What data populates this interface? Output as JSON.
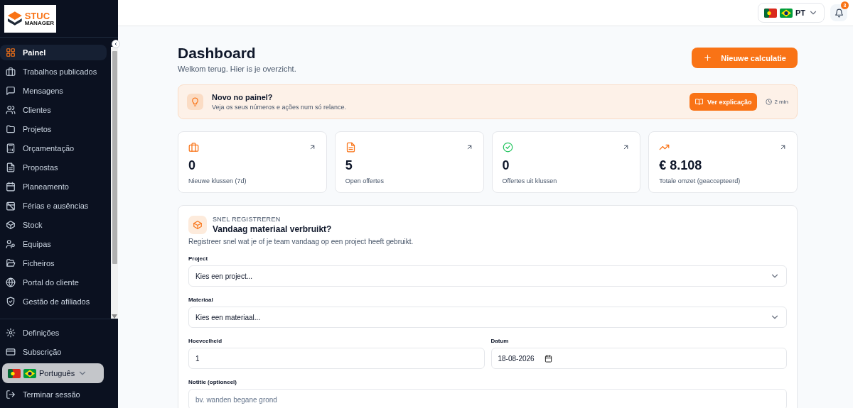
{
  "sidebar": {
    "logo": {
      "word": "STUC",
      "subword": "MANAGER"
    },
    "items": [
      {
        "label": "Painel",
        "selected": true
      },
      {
        "label": "Trabalhos publicados",
        "selected": false
      },
      {
        "label": "Mensagens",
        "selected": false
      },
      {
        "label": "Clientes",
        "selected": false
      },
      {
        "label": "Projetos",
        "selected": false
      },
      {
        "label": "Orçamentação",
        "selected": false
      },
      {
        "label": "Propostas",
        "selected": false
      },
      {
        "label": "Planeamento",
        "selected": false
      },
      {
        "label": "Férias e ausências",
        "selected": false
      },
      {
        "label": "Stock",
        "selected": false
      },
      {
        "label": "Equipas",
        "selected": false
      },
      {
        "label": "Ficheiros",
        "selected": false
      },
      {
        "label": "Portal do cliente",
        "selected": false
      },
      {
        "label": "Gestão de afiliados",
        "selected": false
      }
    ],
    "footer_items": [
      {
        "label": "Definições"
      },
      {
        "label": "Subscrição"
      }
    ],
    "language": "Português",
    "logout": "Terminar sessão"
  },
  "topbar": {
    "language": "PT",
    "notifications": "3"
  },
  "header": {
    "title": "Dashboard",
    "subtitle": "Welkom terug. Hier is je overzicht.",
    "action": "Nieuwe calculatie"
  },
  "banner": {
    "title": "Novo no painel?",
    "text": "Veja os seus números e ações num só relance.",
    "button": "Ver explicação",
    "duration": "2 min"
  },
  "stats": [
    {
      "value": "0",
      "label": "Nieuwe klussen (7d)"
    },
    {
      "value": "5",
      "label": "Open offertes"
    },
    {
      "value": "0",
      "label": "Offertes uit klussen"
    },
    {
      "value": "€ 8.108",
      "label": "Totale omzet (geaccepteerd)"
    }
  ],
  "quick": {
    "eyebrow": "SNEL REGISTREREN",
    "title": "Vandaag materiaal verbruikt?",
    "text": "Registreer snel wat je of je team vandaag op een project heeft gebruikt.",
    "project": {
      "label": "Project",
      "placeholder": "Kies een project..."
    },
    "material": {
      "label": "Materiaal",
      "placeholder": "Kies een materiaal..."
    },
    "quantity": {
      "label": "Hoeveelheid",
      "value": "1"
    },
    "date": {
      "label": "Datum",
      "value": "18-08-2026"
    },
    "note": {
      "label": "Notitie (optioneel)",
      "placeholder": "bv. wanden begane grond"
    }
  }
}
